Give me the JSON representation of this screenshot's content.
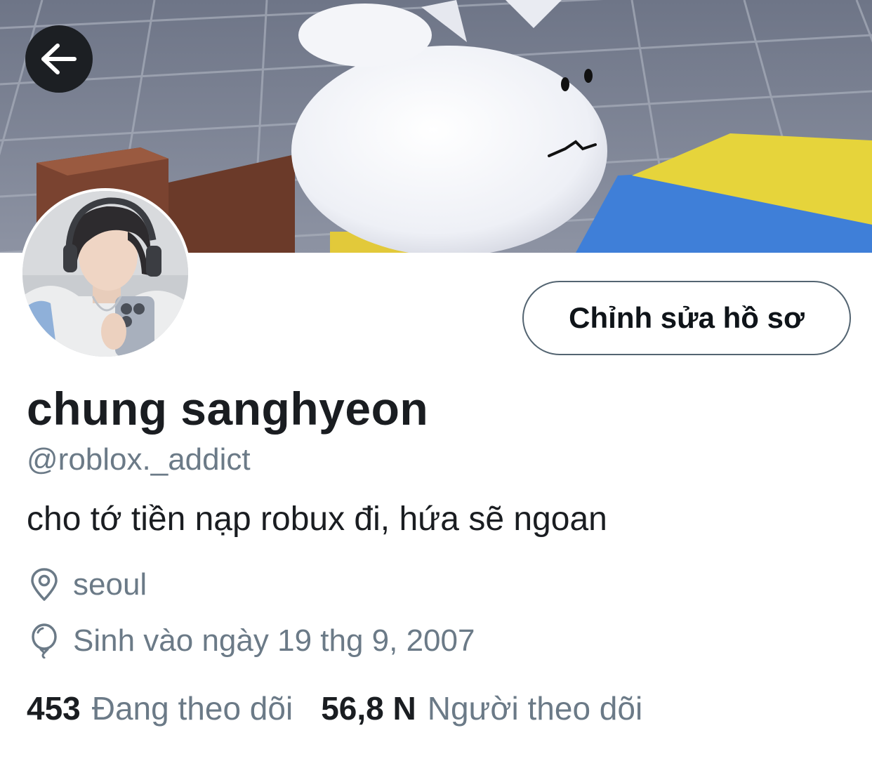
{
  "header": {
    "back_icon": "arrow-left-icon"
  },
  "profile": {
    "display_name": "chung sanghyeon",
    "handle": "@roblox._addict",
    "bio": "cho tớ tiền nạp robux đi, hứa sẽ ngoan",
    "edit_button_label": "Chỉnh sửa hồ sơ",
    "location": {
      "icon": "location-pin-icon",
      "text": "seoul"
    },
    "birthday": {
      "icon": "balloon-icon",
      "text": "Sinh vào ngày 19 thg 9, 2007"
    }
  },
  "stats": {
    "following_count": "453",
    "following_label": "Đang theo dõi",
    "followers_count": "56,8 N",
    "followers_label": "Người theo dõi"
  },
  "colors": {
    "text_primary": "#1a1d21",
    "text_secondary": "#6b7a87",
    "button_border": "#536471",
    "back_button_bg": "#1c1f23"
  }
}
